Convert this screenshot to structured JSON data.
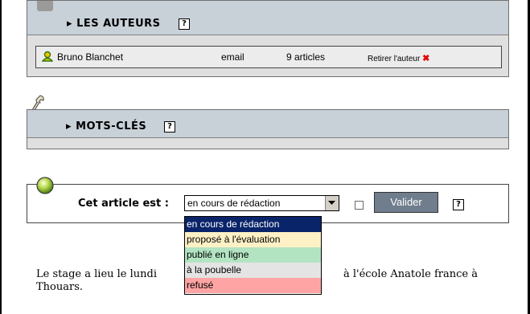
{
  "auteurs": {
    "title": "LES AUTEURS",
    "help": "?",
    "author": {
      "name": "Bruno Blanchet",
      "email": "email",
      "articles": "9 articles",
      "remove": "Retirer l'auteur",
      "remove_icon": "✖"
    }
  },
  "mots_cles": {
    "title": "MOTS-CLÉS",
    "help": "?"
  },
  "statut": {
    "label": "Cet article est :",
    "selected": "en cours de rédaction",
    "submit": "Valider",
    "help": "?",
    "options": [
      {
        "label": "en cours de rédaction",
        "color": "#0a246a"
      },
      {
        "label": "proposé à l'évaluation",
        "color": "#fff1c6"
      },
      {
        "label": "publié en ligne",
        "color": "#b3e4c2"
      },
      {
        "label": "à la poubelle",
        "color": "#e4e4e4"
      },
      {
        "label": "refusé",
        "color": "#ffa4a4"
      }
    ]
  },
  "paragraph": {
    "line1_left": "Le stage a lieu le lundi",
    "line1_right": "à l'école Anatole france à",
    "line2": "Thouars."
  },
  "icons": {
    "folder": "folder-icon",
    "user": "user-icon",
    "wrench": "wrench-icon",
    "status": "status-ball-icon"
  }
}
